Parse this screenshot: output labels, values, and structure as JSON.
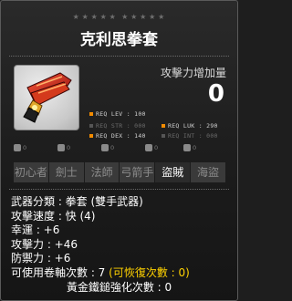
{
  "item": {
    "name": "克利思拳套",
    "stars": [
      "★",
      "★",
      "★",
      "★",
      "★",
      "★",
      "★",
      "★",
      "★",
      "★"
    ]
  },
  "attack_increase": {
    "label": "攻擊力增加量",
    "value": "0"
  },
  "requirements": {
    "lev": "REQ LEV : 100",
    "str": "REQ STR : 000",
    "luk": "REQ LUK : 290",
    "dex": "REQ DEX : 140",
    "int": "REQ INT : 000"
  },
  "flags": [
    {
      "icon": "sword-tag-icon",
      "value": "0"
    },
    {
      "icon": "bag-icon",
      "value": "0"
    },
    {
      "icon": "potion-icon",
      "value": "0"
    },
    {
      "icon": "shield-icon",
      "value": "0"
    },
    {
      "icon": "percent-icon",
      "value": "0"
    }
  ],
  "classes": [
    "初心者",
    "劍士",
    "法師",
    "弓箭手",
    "盜賊",
    "海盜"
  ],
  "active_class": "盜賊",
  "stats": {
    "weapon_type": "武器分類 : 拳套 (雙手武器)",
    "attack_speed": "攻擊速度 : 快 (4)",
    "luck": "幸運 : +6",
    "attack": "攻擊力 : +46",
    "defense": "防禦力 : +6",
    "scroll_prefix": "可使用卷軸次數 : 7",
    "scroll_recover": "(可恢復次數 : 0)",
    "gold_hammer": "黃金鐵鎚強化次數 : 0"
  },
  "colors": {
    "background": "#1e1e1e",
    "text": "#ffffff",
    "highlight": "#ffd200",
    "dim": "#6b6b6b"
  }
}
